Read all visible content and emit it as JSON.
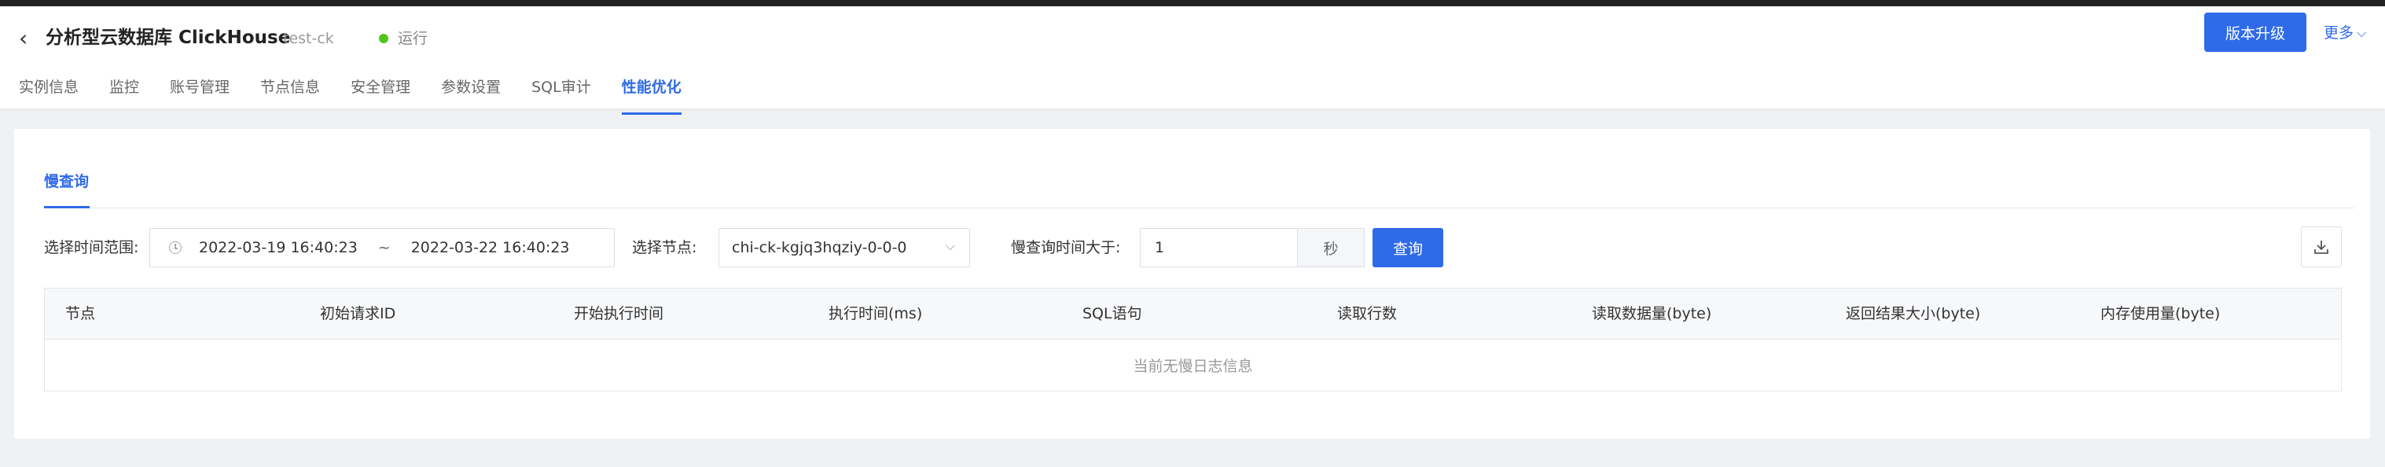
{
  "header": {
    "title": "分析型云数据库 ClickHouse",
    "instance_id": "test-ck",
    "status": "运行",
    "upgrade_label": "版本升级",
    "more_label": "更多"
  },
  "tabs": [
    {
      "label": "实例信息"
    },
    {
      "label": "监控"
    },
    {
      "label": "账号管理"
    },
    {
      "label": "节点信息"
    },
    {
      "label": "安全管理"
    },
    {
      "label": "参数设置"
    },
    {
      "label": "SQL审计"
    },
    {
      "label": "性能优化",
      "active": true
    }
  ],
  "slowquery": {
    "tab_label": "慢查询",
    "time_range_label": "选择时间范围:",
    "start_time": "2022-03-19 16:40:23",
    "separator": "~",
    "end_time": "2022-03-22 16:40:23",
    "node_label": "选择节点:",
    "node_value": "chi-ck-kgjq3hqziy-0-0-0",
    "threshold_label": "慢查询时间大于:",
    "threshold_value": "1",
    "threshold_unit": "秒",
    "query_label": "查询"
  },
  "table": {
    "columns": [
      "节点",
      "初始请求ID",
      "开始执行时间",
      "执行时间(ms)",
      "SQL语句",
      "读取行数",
      "读取数据量(byte)",
      "返回结果大小(byte)",
      "内存使用量(byte)"
    ],
    "empty_text": "当前无慢日志信息"
  },
  "colors": {
    "accent": "#2f6be8",
    "status_running": "#52c41a"
  }
}
